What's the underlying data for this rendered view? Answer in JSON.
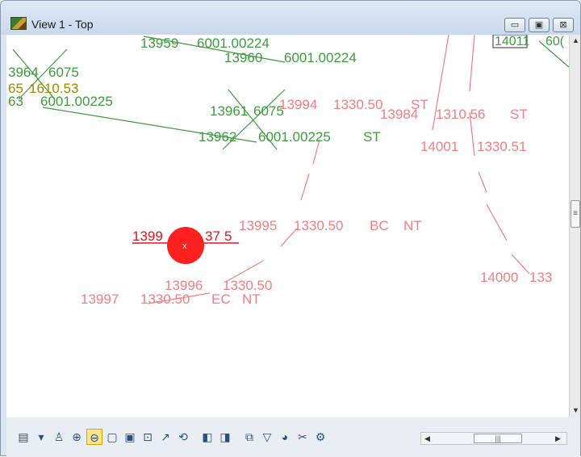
{
  "window": {
    "title": "View 1 - Top",
    "buttons": {
      "minimize": "▭",
      "maximize": "▣",
      "close": "⊠"
    }
  },
  "canvas": {
    "labels": {
      "l1": "13959",
      "l2": "6001.00224",
      "l3": "13960",
      "l4": "6001.00224",
      "l5": "14011",
      "l6": "60(",
      "l7": "3964",
      "l8": "6075",
      "l9": "65",
      "l10": "1610.53",
      "l11": "63",
      "l12": "6001.00225",
      "l13": "13961",
      "l14": "6075",
      "l15": "13994",
      "l16": "1330.50",
      "l17": "ST",
      "l18": "13984",
      "l19": "1310.56",
      "l20": "ST",
      "l21": "13962",
      "l22": "6001.00225",
      "l23": "ST",
      "l24": "14001",
      "l25": "1330.51",
      "l26": "13995",
      "l27": "1330.50",
      "l28": "BC",
      "l29": "NT",
      "l30": "1399",
      "l31": "37",
      "l32": "5",
      "l33": "13996",
      "l34": "1330.50",
      "l35": "14000",
      "l36": "133",
      "l37": "13997",
      "l38": "1330.50",
      "l39": "EC",
      "l40": "NT"
    },
    "colors": {
      "green": "#3f9a3f",
      "pink": "#f07f84",
      "olive": "#a08a00",
      "red": "#ff2020",
      "selection": "#e8121a"
    }
  },
  "toolbar": {
    "icons": [
      "view-menu-icon",
      "dropdown-arrow-icon",
      "paint-icon",
      "zoom-in-icon",
      "zoom-out-icon",
      "window-area-icon",
      "fit-view-icon",
      "rotate-view-icon",
      "pan-icon",
      "update-view-icon",
      "previous-view-icon",
      "next-view-icon",
      "copy-view-icon",
      "filter-icon",
      "color-icon",
      "tools-icon",
      "settings-icon"
    ]
  }
}
